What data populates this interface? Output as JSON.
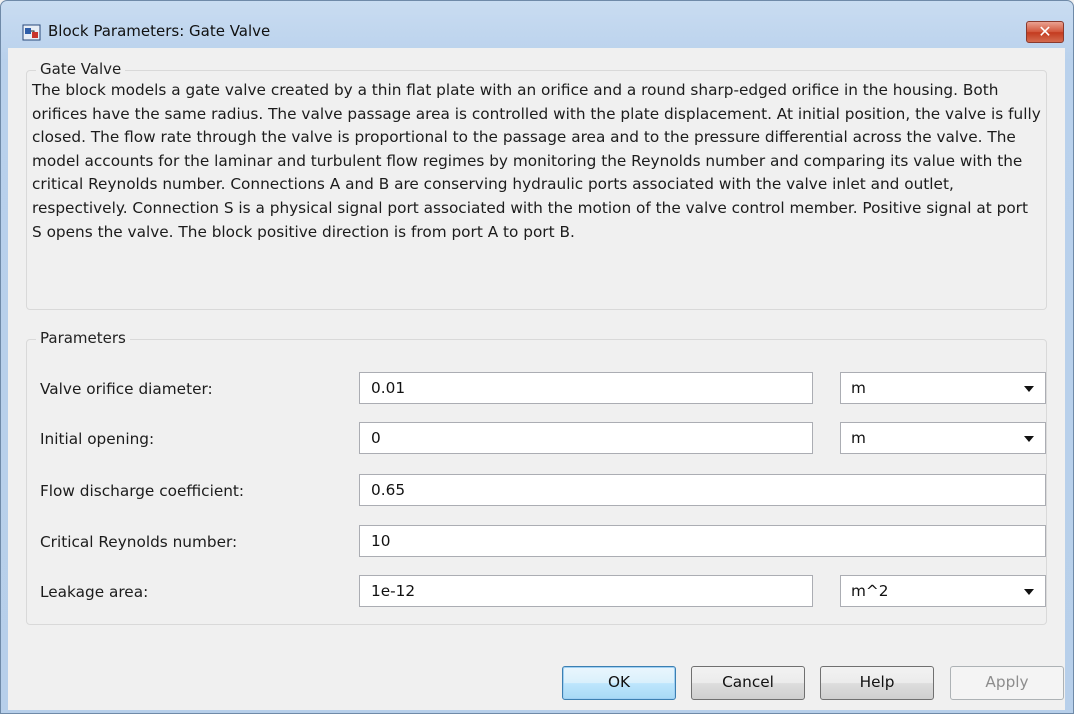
{
  "window": {
    "title": "Block Parameters: Gate Valve",
    "close_label": "✕"
  },
  "description_group": {
    "title": "Gate Valve",
    "text": "The block models a gate valve created by a thin flat plate with an orifice and a round sharp-edged orifice in the housing. Both orifices have the same radius. The valve passage area is controlled with the plate displacement. At initial position, the valve is fully closed. The flow rate through the valve is proportional to the passage area and to the pressure differential across the valve. The model accounts for the laminar and turbulent flow regimes by monitoring the Reynolds number and comparing its value with the critical Reynolds number. Connections A and B are conserving hydraulic ports associated with the valve inlet and outlet, respectively. Connection S is a physical signal port associated with the motion of the valve control member. Positive signal at port S opens the valve. The block positive direction is from port A to port B."
  },
  "parameters_group": {
    "title": "Parameters",
    "rows": [
      {
        "label": "Valve orifice diameter:",
        "value": "0.01",
        "unit": "m"
      },
      {
        "label": "Initial opening:",
        "value": "0",
        "unit": "m"
      },
      {
        "label": "Flow discharge coefficient:",
        "value": "0.65"
      },
      {
        "label": "Critical Reynolds number:",
        "value": "10"
      },
      {
        "label": "Leakage area:",
        "value": "1e-12",
        "unit": "m^2"
      }
    ]
  },
  "buttons": {
    "ok": "OK",
    "cancel": "Cancel",
    "help": "Help",
    "apply": "Apply"
  },
  "colors": {
    "title_bar": "#b9d1ec",
    "close_button": "#c33a1f",
    "dialog_background": "#f0f0f0",
    "ok_button_accent": "#3c7fb1"
  }
}
